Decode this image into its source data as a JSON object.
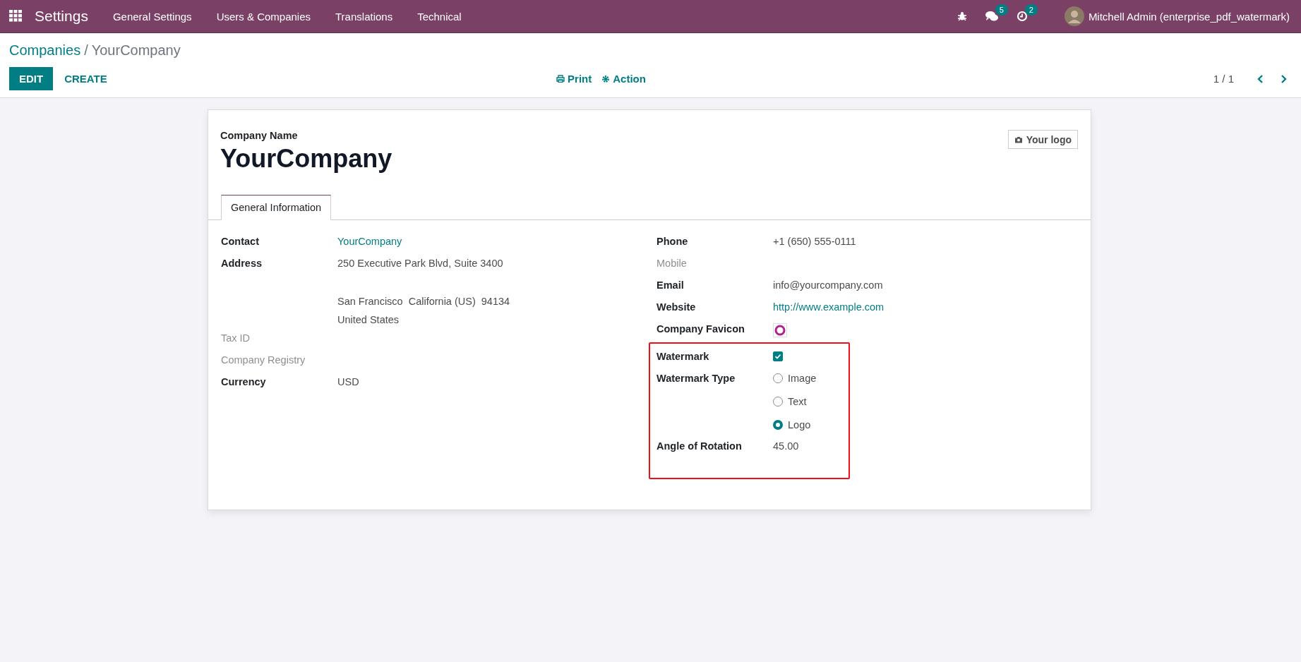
{
  "navbar": {
    "app_title": "Settings",
    "menu": [
      "General Settings",
      "Users & Companies",
      "Translations",
      "Technical"
    ],
    "messages_count": "5",
    "activities_count": "2",
    "user_name": "Mitchell Admin (enterprise_pdf_watermark)"
  },
  "breadcrumb": {
    "parent": "Companies",
    "separator": "/",
    "current": "YourCompany"
  },
  "control_panel": {
    "edit_button": "EDIT",
    "create_button": "CREATE",
    "print_button": "Print",
    "action_button": "Action",
    "pager": "1 / 1"
  },
  "sheet": {
    "name_label": "Company Name",
    "name": "YourCompany",
    "logo_button": "Your logo",
    "tabs": [
      {
        "label": "General Information",
        "selected": true
      }
    ],
    "left_fields": [
      {
        "label": "Contact",
        "kind": "link",
        "empty": false,
        "value": "YourCompany"
      },
      {
        "label": "Address",
        "kind": "address",
        "empty": false,
        "street": "250 Executive Park Blvd, Suite 3400",
        "city": "San Francisco",
        "state": "California (US)",
        "zip": "94134",
        "country": "United States"
      },
      {
        "label": "Tax ID",
        "empty": true
      },
      {
        "label": "Company Registry",
        "empty": true
      },
      {
        "label": "Currency",
        "kind": "text",
        "empty": false,
        "value": "USD"
      }
    ],
    "right_fields": [
      {
        "label": "Phone",
        "kind": "text",
        "empty": false,
        "value": "+1 (650) 555-0111"
      },
      {
        "label": "Mobile",
        "empty": true
      },
      {
        "label": "Email",
        "kind": "text",
        "empty": false,
        "value": "info@yourcompany.com"
      },
      {
        "label": "Website",
        "kind": "link",
        "empty": false,
        "value": "http://www.example.com"
      },
      {
        "label": "Company Favicon",
        "kind": "favicon",
        "empty": false
      }
    ],
    "highlighted_fields": [
      {
        "label": "Watermark",
        "kind": "checkbox",
        "empty": false,
        "checked": true
      },
      {
        "label": "Watermark Type",
        "kind": "radio",
        "empty": false,
        "options": [
          {
            "label": "Image",
            "selected": false
          },
          {
            "label": "Text",
            "selected": false
          },
          {
            "label": "Logo",
            "selected": true
          }
        ]
      },
      {
        "label": "Angle of Rotation",
        "kind": "text",
        "empty": false,
        "value": "45.00"
      }
    ]
  }
}
